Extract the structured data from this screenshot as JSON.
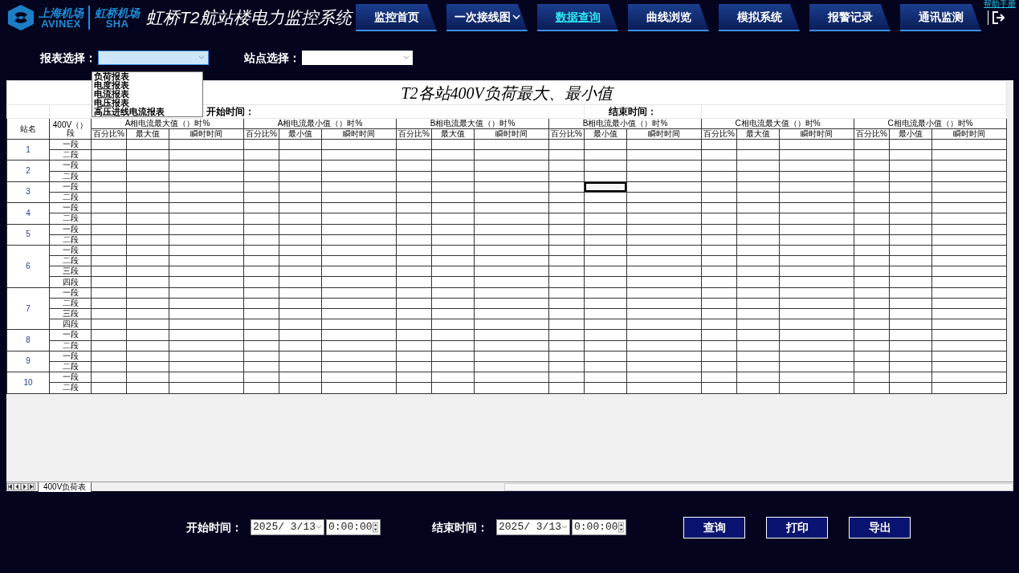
{
  "header": {
    "logo_left": "上海机场",
    "logo_left_en": "AVINEX",
    "logo_right": "虹桥机场",
    "logo_right_en": "SHA",
    "title": "虹桥T2航站楼电力监控系统",
    "help": "帮助手册"
  },
  "nav": [
    {
      "label": "监控首页",
      "selected": false,
      "dropdown": false
    },
    {
      "label": "一次接线图",
      "selected": false,
      "dropdown": true
    },
    {
      "label": "数据查询",
      "selected": true,
      "dropdown": false
    },
    {
      "label": "曲线浏览",
      "selected": false,
      "dropdown": false
    },
    {
      "label": "模拟系统",
      "selected": false,
      "dropdown": false
    },
    {
      "label": "报警记录",
      "selected": false,
      "dropdown": false
    },
    {
      "label": "通讯监测",
      "selected": false,
      "dropdown": false
    }
  ],
  "filters": {
    "report_label": "报表选择：",
    "report_open": true,
    "report_options": [
      "负荷报表",
      "电度报表",
      "电流报表",
      "电压报表",
      "高压进线电流报表"
    ],
    "station_label": "站点选择："
  },
  "sheet": {
    "title": "T2各站400V负荷最大、最小值",
    "start_label": "开始时间：",
    "end_label": "结束时间：",
    "col_station": "站名",
    "col_segment": "400V（）段",
    "groups": [
      {
        "title": "A相电流最大值（）时%",
        "subs": [
          "百分比%",
          "最大值",
          "瞬时时间"
        ]
      },
      {
        "title": "A相电流最小值（）时%",
        "subs": [
          "百分比%",
          "最小值",
          "瞬时时间"
        ]
      },
      {
        "title": "B相电流最大值（）时%",
        "subs": [
          "百分比%",
          "最大值",
          "瞬时时间"
        ]
      },
      {
        "title": "B相电流最小值（）时%",
        "subs": [
          "百分比%",
          "最小值",
          "瞬时时间"
        ]
      },
      {
        "title": "C相电流最大值（）时%",
        "subs": [
          "百分比%",
          "最大值",
          "瞬时时间"
        ]
      },
      {
        "title": "C相电流最小值（）时%",
        "subs": [
          "百分比%",
          "最小值",
          "瞬时时间"
        ]
      }
    ],
    "stations": [
      {
        "name": "1",
        "segments": [
          {
            "label": "一段",
            "selected": false
          },
          {
            "label": "二段",
            "selected": false
          }
        ]
      },
      {
        "name": "2",
        "segments": [
          {
            "label": "一段",
            "selected": false
          },
          {
            "label": "二段",
            "selected": false
          }
        ]
      },
      {
        "name": "3",
        "segments": [
          {
            "label": "一段",
            "selected": true
          },
          {
            "label": "二段",
            "selected": false
          }
        ]
      },
      {
        "name": "4",
        "segments": [
          {
            "label": "一段",
            "selected": false
          },
          {
            "label": "二段",
            "selected": false
          }
        ]
      },
      {
        "name": "5",
        "segments": [
          {
            "label": "一段",
            "selected": false
          },
          {
            "label": "二段",
            "selected": false
          }
        ]
      },
      {
        "name": "6",
        "segments": [
          {
            "label": "一段",
            "selected": false
          },
          {
            "label": "二段",
            "selected": false
          },
          {
            "label": "三段",
            "selected": false
          },
          {
            "label": "四段",
            "selected": false
          }
        ]
      },
      {
        "name": "7",
        "segments": [
          {
            "label": "一段",
            "selected": false
          },
          {
            "label": "二段",
            "selected": false
          },
          {
            "label": "三段",
            "selected": false
          },
          {
            "label": "四段",
            "selected": false
          }
        ]
      },
      {
        "name": "8",
        "segments": [
          {
            "label": "一段",
            "selected": false
          },
          {
            "label": "二段",
            "selected": false
          }
        ]
      },
      {
        "name": "9",
        "segments": [
          {
            "label": "一段",
            "selected": false
          },
          {
            "label": "二段",
            "selected": false
          }
        ]
      },
      {
        "name": "10",
        "segments": [
          {
            "label": "一段",
            "selected": false
          },
          {
            "label": "二段",
            "selected": false
          }
        ]
      }
    ],
    "tabs": [
      {
        "label": "400V负荷表",
        "selected": true
      }
    ]
  },
  "query": {
    "start_label": "开始时间：",
    "start_date": "2025/ 3/13",
    "start_time": "0:00:00",
    "end_label": "结束时间：",
    "end_date": "2025/ 3/13",
    "end_time": "0:00:00",
    "buttons": [
      "查询",
      "打印",
      "导出"
    ]
  }
}
